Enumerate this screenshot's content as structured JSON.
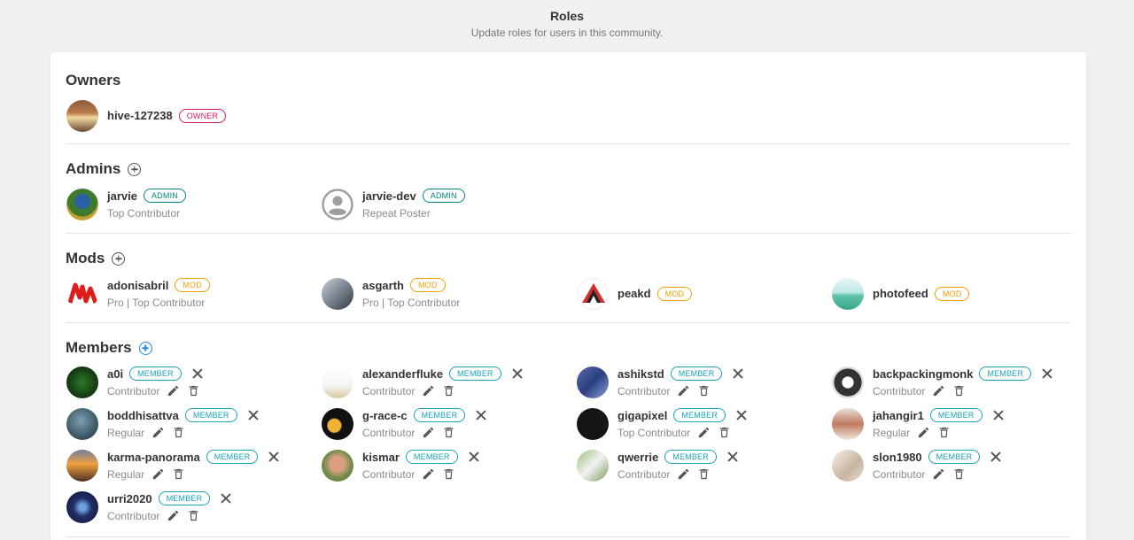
{
  "header": {
    "title": "Roles",
    "subtitle": "Update roles for users in this community."
  },
  "sections": {
    "owners": "Owners",
    "admins": "Admins",
    "mods": "Mods",
    "members": "Members"
  },
  "colors": {
    "owner": "#d81b60",
    "admin": "#00897b",
    "mod": "#f5a000",
    "member": "#1aa3b8",
    "add_members": "#1e88e5"
  },
  "owners": [
    {
      "name": "hive-127238",
      "badge": "OWNER"
    }
  ],
  "admins": [
    {
      "name": "jarvie",
      "badge": "ADMIN",
      "title": "Top Contributor"
    },
    {
      "name": "jarvie-dev",
      "badge": "ADMIN",
      "title": "Repeat Poster"
    }
  ],
  "mods": [
    {
      "name": "adonisabril",
      "badge": "MOD",
      "title": "Pro | Top Contributor"
    },
    {
      "name": "asgarth",
      "badge": "MOD",
      "title": "Pro | Top Contributor"
    },
    {
      "name": "peakd",
      "badge": "MOD"
    },
    {
      "name": "photofeed",
      "badge": "MOD"
    }
  ],
  "members": [
    {
      "name": "a0i",
      "badge": "MEMBER",
      "title": "Contributor"
    },
    {
      "name": "alexanderfluke",
      "badge": "MEMBER",
      "title": "Contributor"
    },
    {
      "name": "ashikstd",
      "badge": "MEMBER",
      "title": "Contributor"
    },
    {
      "name": "backpackingmonk",
      "badge": "MEMBER",
      "title": "Contributor"
    },
    {
      "name": "boddhisattva",
      "badge": "MEMBER",
      "title": "Regular"
    },
    {
      "name": "g-race-c",
      "badge": "MEMBER",
      "title": "Contributor"
    },
    {
      "name": "gigapixel",
      "badge": "MEMBER",
      "title": "Top Contributor"
    },
    {
      "name": "jahangir1",
      "badge": "MEMBER",
      "title": "Regular"
    },
    {
      "name": "karma-panorama",
      "badge": "MEMBER",
      "title": "Regular"
    },
    {
      "name": "kismar",
      "badge": "MEMBER",
      "title": "Contributor"
    },
    {
      "name": "qwerrie",
      "badge": "MEMBER",
      "title": "Contributor"
    },
    {
      "name": "slon1980",
      "badge": "MEMBER",
      "title": "Contributor"
    },
    {
      "name": "urri2020",
      "badge": "MEMBER",
      "title": "Contributor"
    }
  ],
  "icons": {
    "add": "plus-circle-icon",
    "remove": "close-icon",
    "edit": "pencil-icon",
    "delete": "trash-icon",
    "default_avatar": "user-circle-icon"
  }
}
